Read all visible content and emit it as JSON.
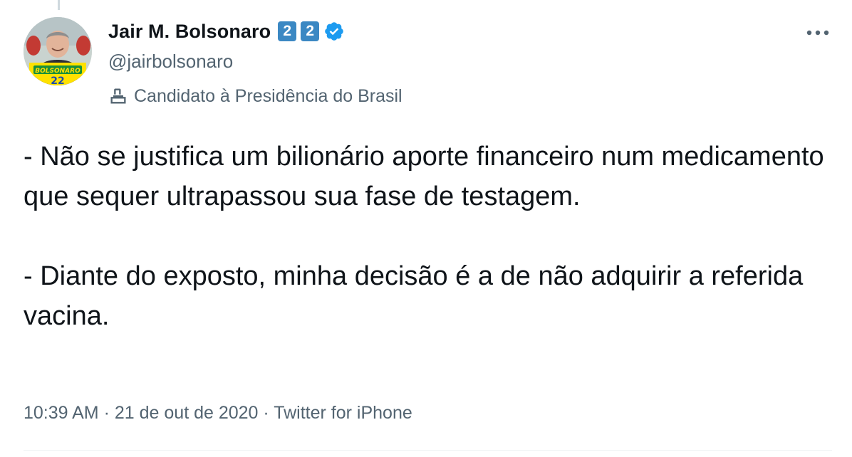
{
  "author": {
    "display_name": "Jair M. Bolsonaro",
    "badges": [
      "2",
      "2"
    ],
    "verified": true,
    "handle": "@jairbolsonaro",
    "label": "Candidato à Presidência do Brasil",
    "avatar_caption": "BOLSONARO",
    "avatar_number": "22"
  },
  "tweet": {
    "paragraphs": [
      "- Não se justifica um bilionário aporte financeiro num medicamento que sequer ultrapassou sua fase de testagem.",
      "- Diante do exposto, minha decisão é a de não adquirir a referida vacina."
    ],
    "time": "10:39 AM",
    "separator": "·",
    "date": "21 de out de 2020",
    "source": "Twitter for iPhone"
  },
  "colors": {
    "text": "#0f1419",
    "secondary": "#536471",
    "verified_blue": "#1d9bf0",
    "badge_blue": "#3b88c3"
  },
  "icons": {
    "more": "more-horizontal-icon",
    "verified": "verified-badge-icon",
    "label": "ballot-box-icon"
  }
}
